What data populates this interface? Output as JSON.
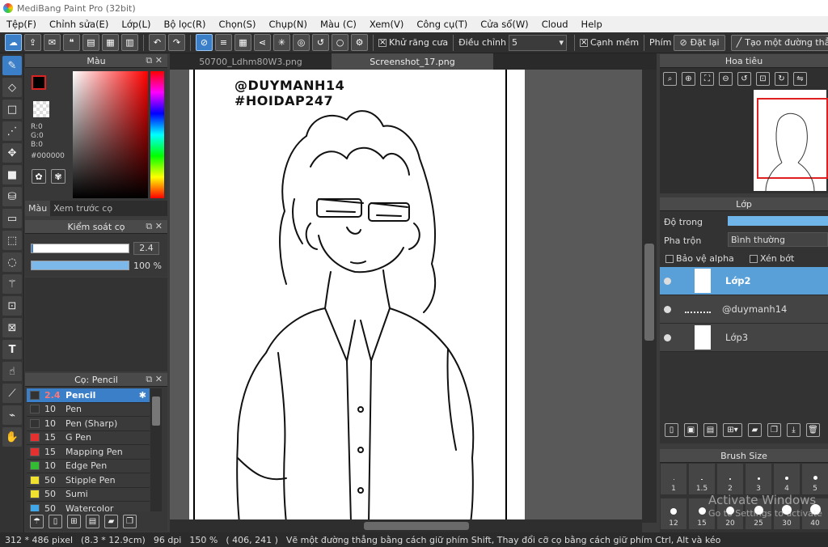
{
  "app": {
    "title": "MediBang Paint Pro (32bit)"
  },
  "menu": [
    "Tệp(F)",
    "Chỉnh sửa(E)",
    "Lớp(L)",
    "Bộ lọc(R)",
    "Chọn(S)",
    "Chụp(N)",
    "Màu (C)",
    "Xem(V)",
    "Công cụ(T)",
    "Cửa sổ(W)",
    "Cloud",
    "Help"
  ],
  "toolbar": {
    "antialias_label": "Khử răng cưa",
    "adjust_label": "Điều chỉnh",
    "adjust_value": "5",
    "sharp_label": "Cạnh mềm",
    "key_label": "Phím",
    "reset_label": "Đặt lại",
    "straight_label": "Tạo một đường thẳng"
  },
  "color_panel": {
    "title": "Màu",
    "r": "R:0",
    "g": "G:0",
    "b": "B:0",
    "hex": "#000000",
    "tab_color": "Màu",
    "tab_preview": "Xem trước cọ",
    "fg": "#000000",
    "bg": "#555555"
  },
  "brush_control": {
    "title": "Kiểm soát cọ",
    "size": "2.4",
    "opacity": "100 %",
    "size_fraction": 0.02,
    "opacity_fraction": 1.0
  },
  "brush_panel": {
    "title": "Cọ: Pencil",
    "items": [
      {
        "size": "2.4",
        "name": "Pencil",
        "color": "#333333",
        "active": true
      },
      {
        "size": "10",
        "name": "Pen",
        "color": "#333333"
      },
      {
        "size": "10",
        "name": "Pen (Sharp)",
        "color": "#333333"
      },
      {
        "size": "15",
        "name": "G Pen",
        "color": "#e53030"
      },
      {
        "size": "15",
        "name": "Mapping Pen",
        "color": "#e53030"
      },
      {
        "size": "10",
        "name": "Edge Pen",
        "color": "#33bb33"
      },
      {
        "size": "50",
        "name": "Stipple Pen",
        "color": "#f0e030"
      },
      {
        "size": "50",
        "name": "Sumi",
        "color": "#f0e030"
      },
      {
        "size": "50",
        "name": "Watercolor",
        "color": "#40a8e8"
      }
    ]
  },
  "tabs": [
    "50700_Ldhm80W3.png",
    "Screenshot_17.png"
  ],
  "drawing": {
    "line1": "@DUYMANH14",
    "line2": "#HOIDAP247"
  },
  "navigator": {
    "title": "Hoa tiêu"
  },
  "layer_panel": {
    "title": "Lớp",
    "opacity_label": "Độ trong",
    "blend_label": "Pha trộn",
    "blend_value": "Bình thường",
    "protect_alpha": "Bảo vệ alpha",
    "clipping": "Xén bớt",
    "layers": [
      {
        "name": "Lớp2",
        "active": true
      },
      {
        "name": "@duymanh14"
      },
      {
        "name": "Lớp3"
      }
    ]
  },
  "brush_size": {
    "title": "Brush Size",
    "sizes": [
      "1",
      "1.5",
      "2",
      "3",
      "4",
      "5",
      "12",
      "15",
      "20",
      "25",
      "30",
      "40"
    ]
  },
  "watermark": {
    "line1": "Activate Windows",
    "line2": "Go to Settings to activate"
  },
  "status": {
    "size": "312 * 486 pixel",
    "cm": "(8.3 * 12.9cm)",
    "dpi": "96 dpi",
    "zoom": "150 %",
    "coords": "( 406, 241 )",
    "hint": "Vẽ một đường thẳng bằng cách giữ phím Shift, Thay đổi cỡ cọ bằng cách giữ phím Ctrl, Alt và kéo"
  }
}
